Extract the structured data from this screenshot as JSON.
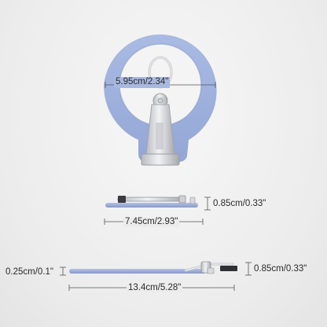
{
  "dimensions": {
    "top_width": "5.95cm/2.34\"",
    "side_thickness": "0.85cm/0.33\"",
    "side_length": "7.45cm/2.93\"",
    "open_plate_thickness": "0.25cm/0.1\"",
    "open_thickness": "0.85cm/0.33\"",
    "open_length": "13.4cm/5.28\""
  },
  "colors": {
    "ring": "#9fb2dc",
    "ring_shadow": "#8a9dcc",
    "metal": "#d9dadd",
    "metal_dark": "#9c9ea3",
    "dimension_line": "#555555",
    "text": "#2b2b2b"
  }
}
